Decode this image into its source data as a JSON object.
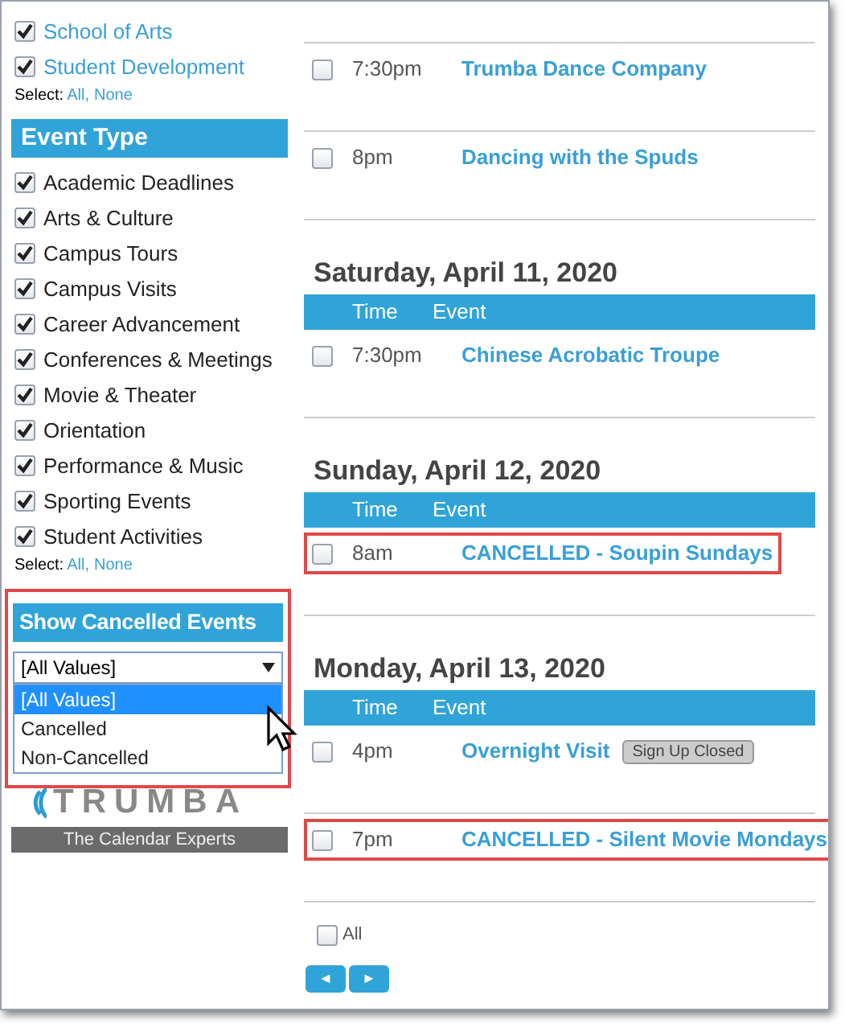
{
  "sidebar": {
    "top_items": [
      {
        "label": "School of Arts",
        "checked": true
      },
      {
        "label": "Student Development",
        "checked": true
      }
    ],
    "top_select": {
      "label": "Select:",
      "links": [
        "All,",
        "None"
      ]
    },
    "event_type": {
      "title": "Event Type",
      "items": [
        {
          "label": "Academic Deadlines",
          "checked": true
        },
        {
          "label": "Arts & Culture",
          "checked": true
        },
        {
          "label": "Campus Tours",
          "checked": true
        },
        {
          "label": "Campus Visits",
          "checked": true
        },
        {
          "label": "Career Advancement",
          "checked": true
        },
        {
          "label": "Conferences & Meetings",
          "checked": true
        },
        {
          "label": "Movie & Theater",
          "checked": true
        },
        {
          "label": "Orientation",
          "checked": true
        },
        {
          "label": "Performance & Music",
          "checked": true
        },
        {
          "label": "Sporting Events",
          "checked": true
        },
        {
          "label": "Student Activities",
          "checked": true
        }
      ],
      "select": {
        "label": "Select:",
        "links": [
          "All,",
          "None"
        ]
      }
    },
    "cancelled_filter": {
      "title": "Show Cancelled Events",
      "annotated": true,
      "value": "[All Values]",
      "options": [
        {
          "label": "[All Values]",
          "selected": true
        },
        {
          "label": "Cancelled",
          "selected": false
        },
        {
          "label": "Non-Cancelled",
          "selected": false
        }
      ]
    },
    "logo": {
      "wordmark": "TRUMBA",
      "tagline": "The Calendar Experts"
    }
  },
  "days": [
    {
      "events": [
        {
          "time": "7:30pm",
          "title": "Trumba Dance Company",
          "checked": false,
          "annotated": false
        },
        {
          "time": "8pm",
          "title": "Dancing with the Spuds",
          "checked": false,
          "annotated": false
        }
      ]
    },
    {
      "heading": "Saturday, April 11, 2020",
      "columns": [
        "Time",
        "Event"
      ],
      "events": [
        {
          "time": "7:30pm",
          "title": "Chinese Acrobatic Troupe",
          "checked": false,
          "annotated": false
        }
      ]
    },
    {
      "heading": "Sunday, April 12, 2020",
      "columns": [
        "Time",
        "Event"
      ],
      "events": [
        {
          "time": "8am",
          "title": "CANCELLED - Soupin Sundays",
          "checked": false,
          "annotated": true
        }
      ]
    },
    {
      "heading": "Monday, April 13, 2020",
      "columns": [
        "Time",
        "Event"
      ],
      "events": [
        {
          "time": "4pm",
          "title": "Overnight Visit",
          "badge": "Sign Up Closed",
          "checked": false,
          "annotated": false
        },
        {
          "time": "7pm",
          "title": "CANCELLED - Silent Movie Mondays",
          "checked": false,
          "annotated": true
        }
      ]
    }
  ],
  "select_all": {
    "label": "All",
    "checked": false
  },
  "pager": [
    "◄",
    "►"
  ]
}
